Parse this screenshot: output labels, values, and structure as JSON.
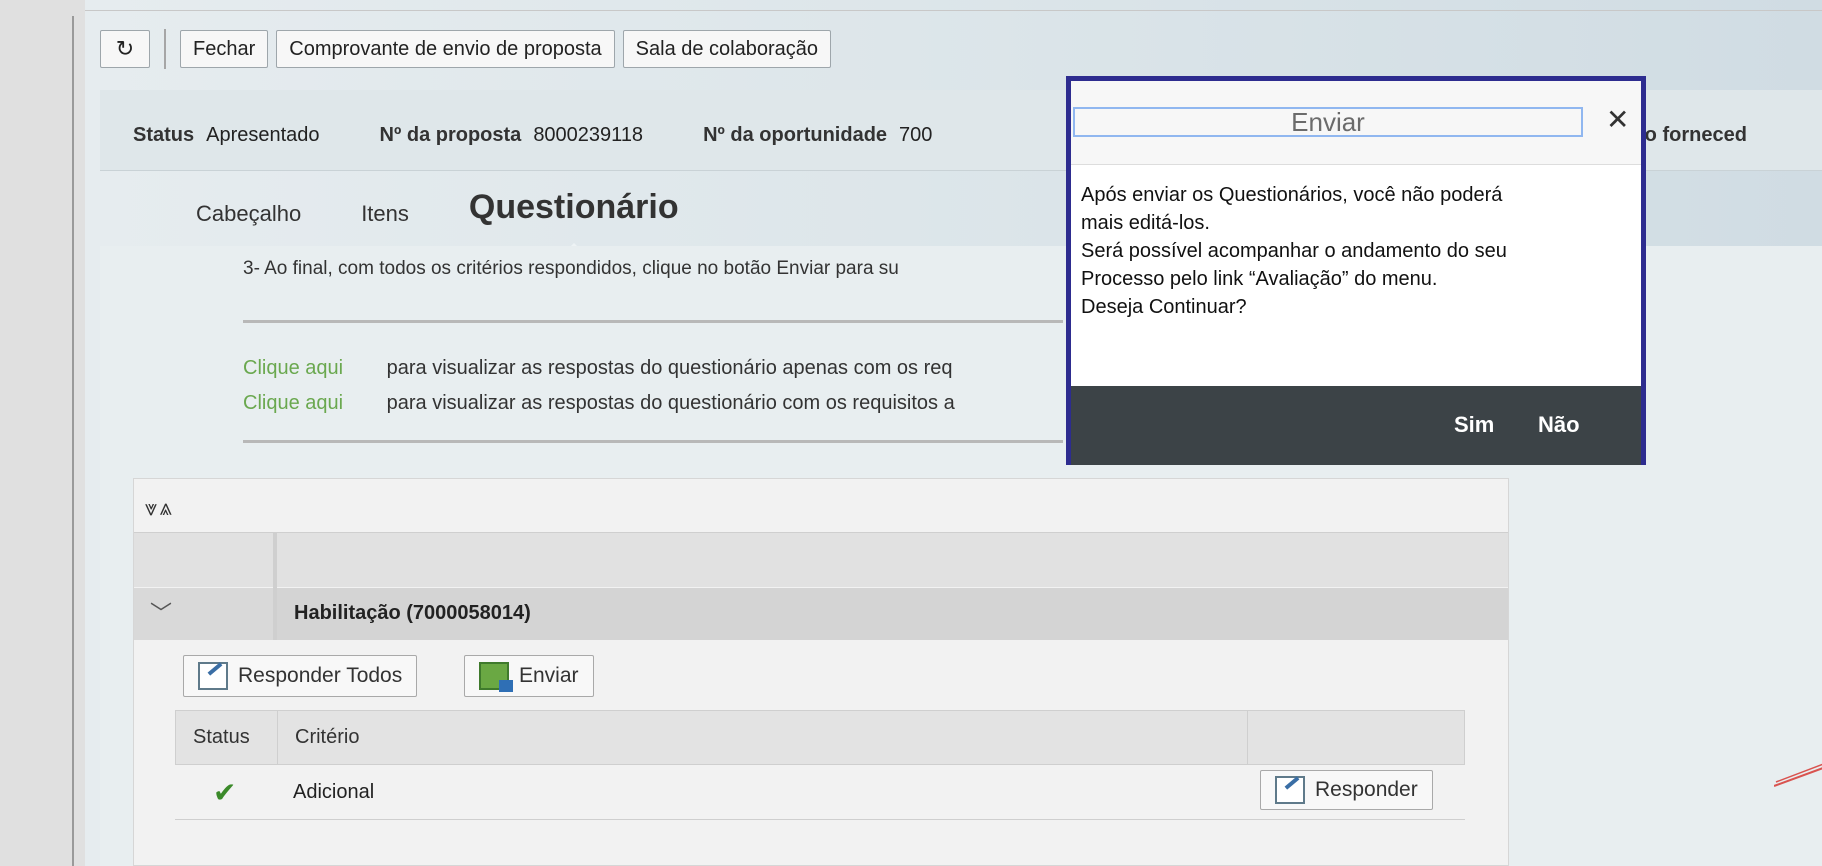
{
  "toolbar": {
    "refresh_icon": "refresh-icon",
    "close_label": "Fechar",
    "receipt_label": "Comprovante de envio de proposta",
    "collab_label": "Sala de colaboração"
  },
  "status_row": {
    "status_label": "Status",
    "status_value": "Apresentado",
    "proposal_label": "Nº da proposta",
    "proposal_value": "8000239118",
    "opportunity_label": "Nº da oportunidade",
    "opportunity_value": "700",
    "supplier_label": "me do forneced"
  },
  "tabs": [
    "Cabeçalho",
    "Itens",
    "Questionário"
  ],
  "instructions": {
    "line3": "3- Ao final, com todos os critérios respondidos, clique no botão Enviar para su",
    "link1": "Clique aqui",
    "text1": "para visualizar as respostas do questionário apenas com os req",
    "link2": "Clique aqui",
    "text2": "para visualizar as respostas do questionário com os requisitos a"
  },
  "group": {
    "expand_icons": "⩔⩓",
    "title": "Habilitação (7000058014)",
    "respond_all_label": "Responder Todos",
    "send_label": "Enviar"
  },
  "criteria_table": {
    "headers": [
      "Status",
      "Critério"
    ],
    "rows": [
      {
        "status_icon": "check-icon",
        "criterion": "Adicional",
        "action_label": "Responder"
      }
    ]
  },
  "modal": {
    "title": "Enviar",
    "close_icon": "close-icon",
    "body_lines": [
      "Após enviar os Questionários, você não poderá",
      "mais editá-los.",
      "Será possível acompanhar o andamento do seu",
      "Processo pelo link “Avaliação” do menu.",
      "Deseja Continuar?"
    ],
    "yes_label": "Sim",
    "no_label": "Não"
  },
  "colors": {
    "modal_border": "#2d2c8f",
    "modal_footer": "#3c4347",
    "link_green": "#6aa84f"
  }
}
